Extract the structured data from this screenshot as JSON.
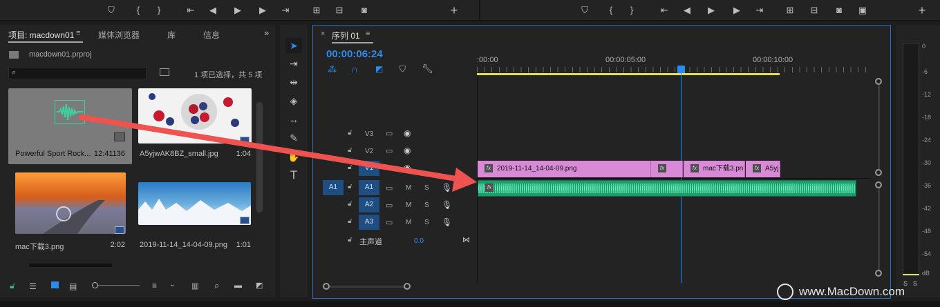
{
  "project_panel": {
    "tabs": [
      "项目: macdown01",
      "媒体浏览器",
      "库",
      "信息"
    ],
    "project_file": "macdown01.prproj",
    "selection_status": "1 项已选择，共 5 项",
    "items": [
      {
        "name": "Powerful Sport Rock...",
        "duration": "12:41136"
      },
      {
        "name": "A5yjwAK8BZ_small.jpg",
        "duration": "1:04"
      },
      {
        "name": "mac下载3.png",
        "duration": "2:02"
      },
      {
        "name": "2019-11-14_14-04-09.png",
        "duration": "1:01"
      }
    ]
  },
  "timeline": {
    "sequence_tab": "序列 01",
    "timecode": "00:00:06:24",
    "ruler_labels": [
      ":00:00",
      "00:00:05:00",
      "00:00:10:00"
    ],
    "video_tracks": [
      "V3",
      "V2",
      "V1"
    ],
    "audio_tracks": [
      "A1",
      "A2",
      "A3"
    ],
    "source_patch": "A1",
    "audio_buttons": {
      "mute": "M",
      "solo": "S"
    },
    "master": {
      "label": "主声道",
      "value": "0.0"
    },
    "clips": [
      {
        "label": "2019-11-14_14-04-09.png"
      },
      {
        "label": ""
      },
      {
        "label": "mac下载3.pn"
      },
      {
        "label": "A5yj"
      }
    ],
    "fx_label": "fx"
  },
  "meter": {
    "scale": [
      "0",
      "-6",
      "-12",
      "-18",
      "-24",
      "-30",
      "-36",
      "-42",
      "-48",
      "-54",
      "dB"
    ],
    "solo_buttons": [
      "S",
      "S"
    ]
  },
  "watermark": "www.MacDown.com",
  "colors": {
    "accent_blue": "#2d8ceb",
    "clip_pink": "#d98ad6",
    "audio_green": "#2fbf86",
    "arrow_red": "#ef5350",
    "work_area_yellow": "#e8e04a"
  }
}
